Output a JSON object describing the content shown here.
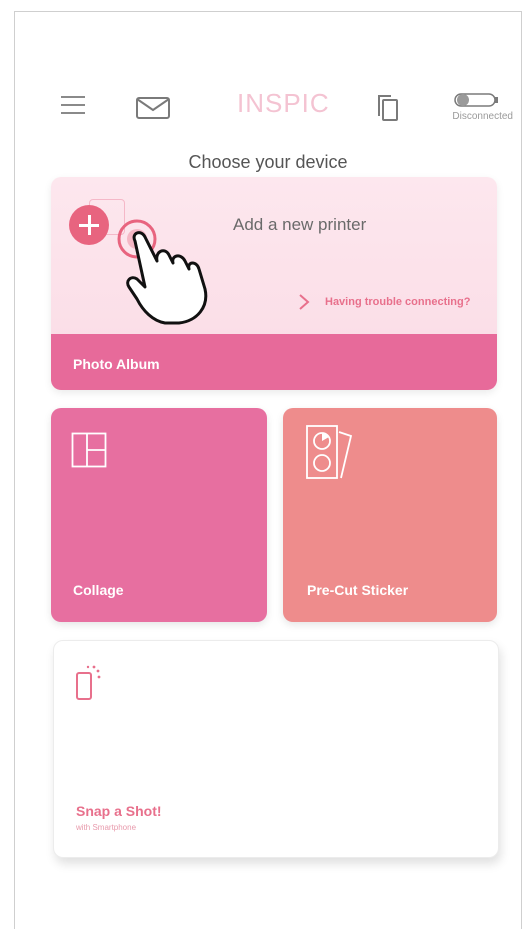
{
  "header": {
    "logo": "INSPIC",
    "connection_status": "Disconnected"
  },
  "page": {
    "title": "Choose your device"
  },
  "printer_card": {
    "add_label": "Add a new printer",
    "trouble_link": "Having trouble connecting?",
    "album_label": "Photo Album"
  },
  "tiles": {
    "collage": "Collage",
    "sticker": "Pre-Cut Sticker"
  },
  "snap": {
    "title": "Snap a Shot!",
    "subtitle": "with Smartphone"
  },
  "icons": {
    "menu": "hamburger-menu-icon",
    "mail": "mail-icon",
    "copy": "copy-icon",
    "toggle": "toggle-icon",
    "add": "plus-icon",
    "hand": "pointing-hand-icon",
    "chevron": "chevron-right-icon",
    "collage": "collage-layout-icon",
    "sticker": "sticker-sheet-icon",
    "phone": "smartphone-icon"
  },
  "colors": {
    "accent": "#e8708c",
    "photo_album": "#e76a9a",
    "collage": "#e76fa0",
    "sticker": "#ee8c8c",
    "logo": "#f4c3d2"
  }
}
